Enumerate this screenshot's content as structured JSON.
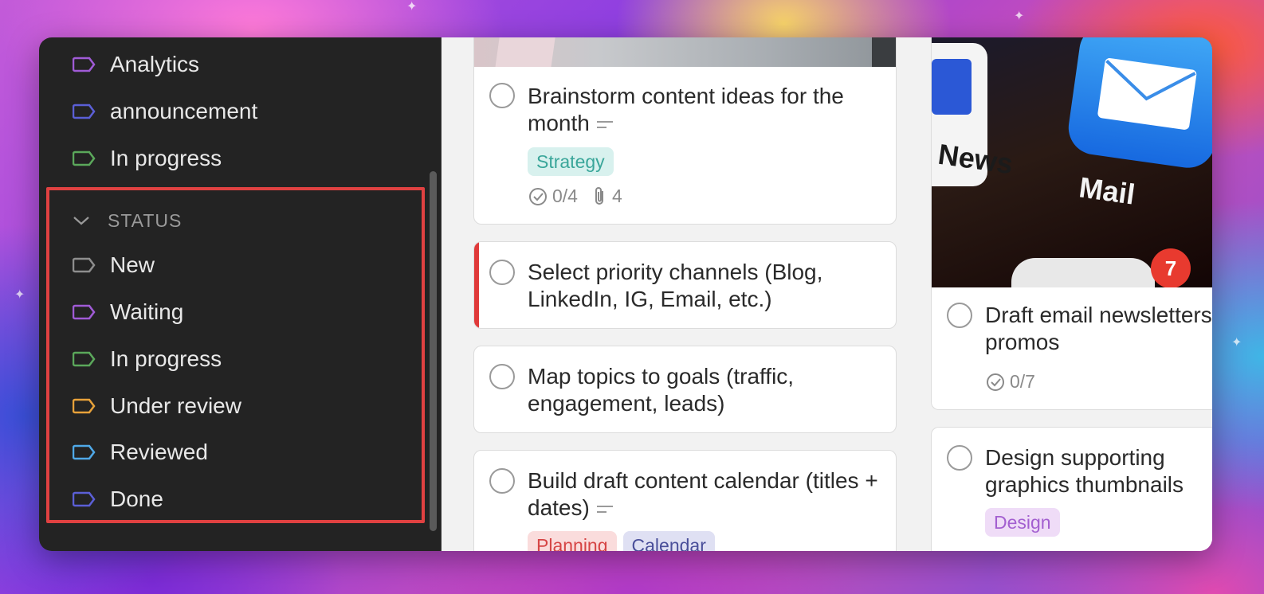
{
  "sidebar": {
    "items_top": [
      {
        "label": "Analytics",
        "color": "#a05bd6"
      },
      {
        "label": "announcement",
        "color": "#5b5fd6"
      },
      {
        "label": "In progress",
        "color": "#5ba85b"
      }
    ],
    "status": {
      "header": "STATUS",
      "items": [
        {
          "label": "New",
          "color": "#8e8e8e"
        },
        {
          "label": "Waiting",
          "color": "#a05bd6"
        },
        {
          "label": "In progress",
          "color": "#5ba85b"
        },
        {
          "label": "Under review",
          "color": "#e8a23a"
        },
        {
          "label": "Reviewed",
          "color": "#4fa9e8"
        },
        {
          "label": "Done",
          "color": "#5b5fd6"
        }
      ]
    }
  },
  "board": {
    "col1": [
      {
        "title": "Brainstorm content ideas for the month",
        "chip": "Strategy",
        "checklist": "0/4",
        "attachments": "4"
      },
      {
        "title": "Select priority channels (Blog, LinkedIn, IG, Email, etc.)"
      },
      {
        "title": "Map topics to goals (traffic, engagement, leads)"
      },
      {
        "title": "Build draft content calendar (titles + dates)",
        "chips": [
          "Planning",
          "Calendar"
        ]
      }
    ],
    "col2": [
      {
        "title": "Draft email newsletters promos",
        "checklist": "0/7",
        "image_labels": {
          "news": "News",
          "mail": "Mail",
          "badge": "7"
        }
      },
      {
        "title": "Design supporting graphics thumbnails",
        "chip": "Design"
      }
    ]
  },
  "colors": {
    "strategy_bg": "#d8f1ee",
    "strategy_fg": "#3aa69a",
    "planning_bg": "#fadcdc",
    "planning_fg": "#d64545",
    "calendar_bg": "#dfe0f3",
    "calendar_fg": "#4a4f9a",
    "design_bg": "#efdcf7",
    "design_fg": "#a35fd0"
  }
}
